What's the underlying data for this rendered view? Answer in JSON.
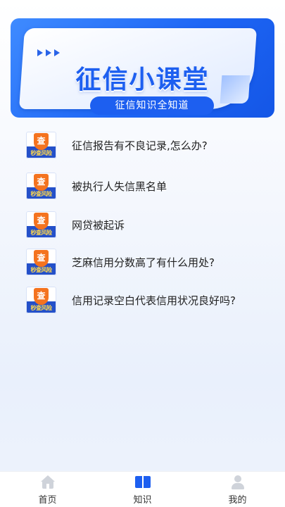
{
  "banner": {
    "title": "征信小课堂",
    "subtitle": "征信知识全知道"
  },
  "badge": {
    "glyph": "查",
    "caption": "秒查风险"
  },
  "articles": [
    {
      "title": "征信报告有不良记录,怎么办?"
    },
    {
      "title": "被执行人失信黑名单"
    },
    {
      "title": "网贷被起诉"
    },
    {
      "title": "芝麻信用分数高了有什么用处?"
    },
    {
      "title": "信用记录空白代表信用状况良好吗?"
    }
  ],
  "tabbar": {
    "home": {
      "label": "首页",
      "icon": "home-icon"
    },
    "knowledge": {
      "label": "知识",
      "icon": "book-icon",
      "active": true
    },
    "mine": {
      "label": "我的",
      "icon": "user-icon"
    }
  },
  "colors": {
    "accent": "#1d5ff0",
    "badge_orange": "#f4731f",
    "badge_blue": "#2450c9"
  }
}
